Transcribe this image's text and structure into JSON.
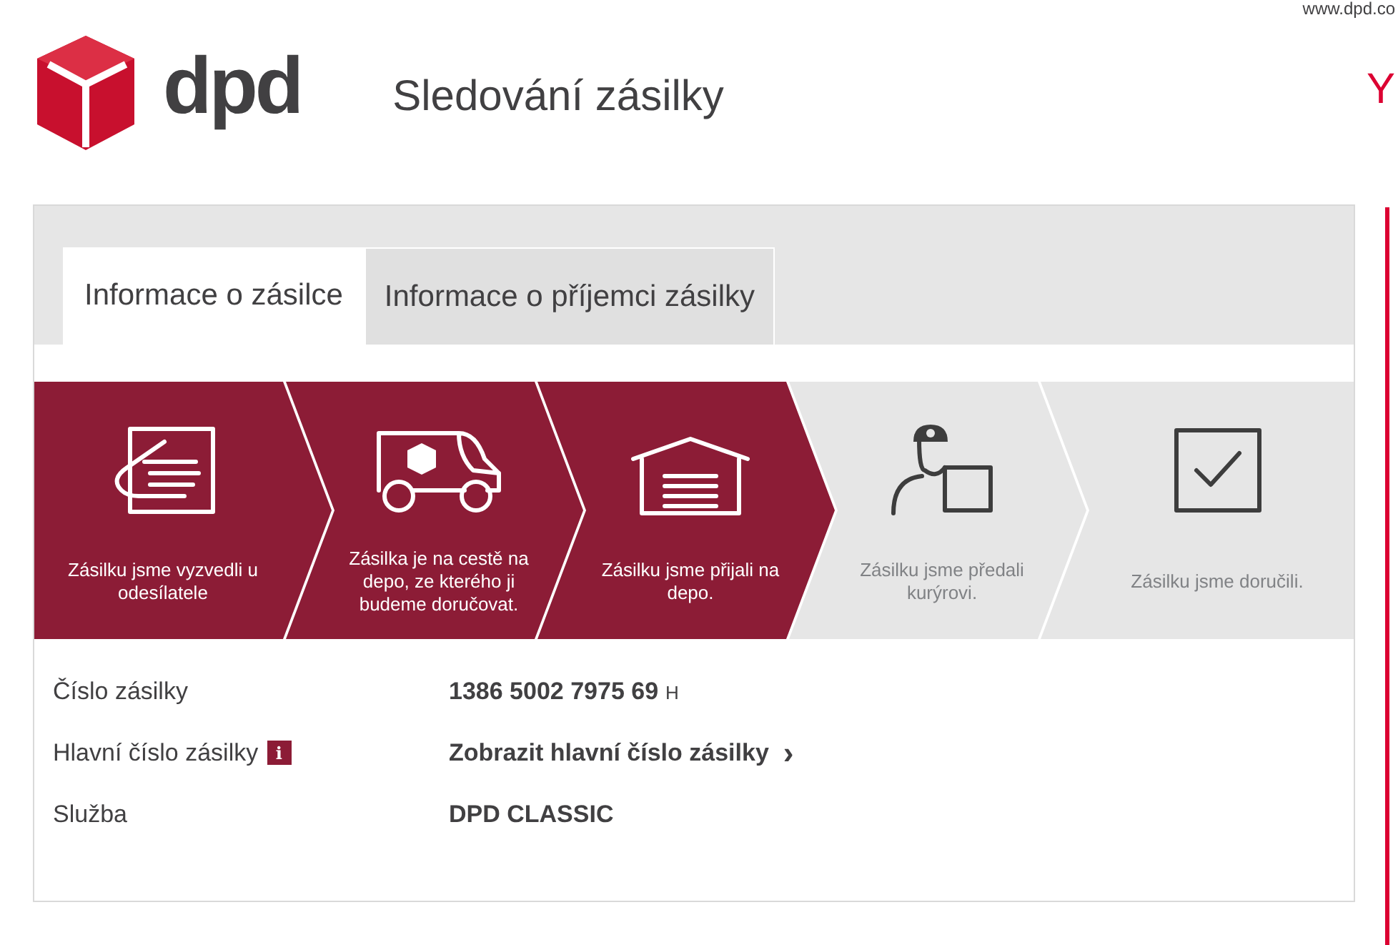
{
  "header": {
    "site_link": "www.dpd.co",
    "logo_text": "dpd",
    "title": "Sledování zásilky",
    "cut_link": "Y"
  },
  "tabs": [
    {
      "label": "Informace o zásilce",
      "selected": true
    },
    {
      "label": "Informace o příjemci zásilky",
      "selected": false
    }
  ],
  "steps": [
    {
      "kind": "pickup",
      "label": "Zásilku jsme vyzvedli u odesílatele",
      "done": true
    },
    {
      "kind": "van",
      "label": "Zásilka je na cestě na depo, ze kterého ji budeme doručovat.",
      "done": true
    },
    {
      "kind": "depot",
      "label": "Zásilku jsme přijali na depo.",
      "done": true
    },
    {
      "kind": "courier",
      "label": "Zásilku jsme předali kurýrovi.",
      "done": false
    },
    {
      "kind": "delivered",
      "label": "Zásilku jsme doručili.",
      "done": false
    }
  ],
  "details": [
    {
      "label": "Číslo zásilky",
      "value": "1386 5002 7975 69",
      "suffix": "H"
    },
    {
      "label": "Hlavní číslo zásilky",
      "info": "i",
      "link": "Zobrazit hlavní číslo zásilky",
      "arrow": "›"
    },
    {
      "label": "Služba",
      "value": "DPD CLASSIC"
    }
  ]
}
